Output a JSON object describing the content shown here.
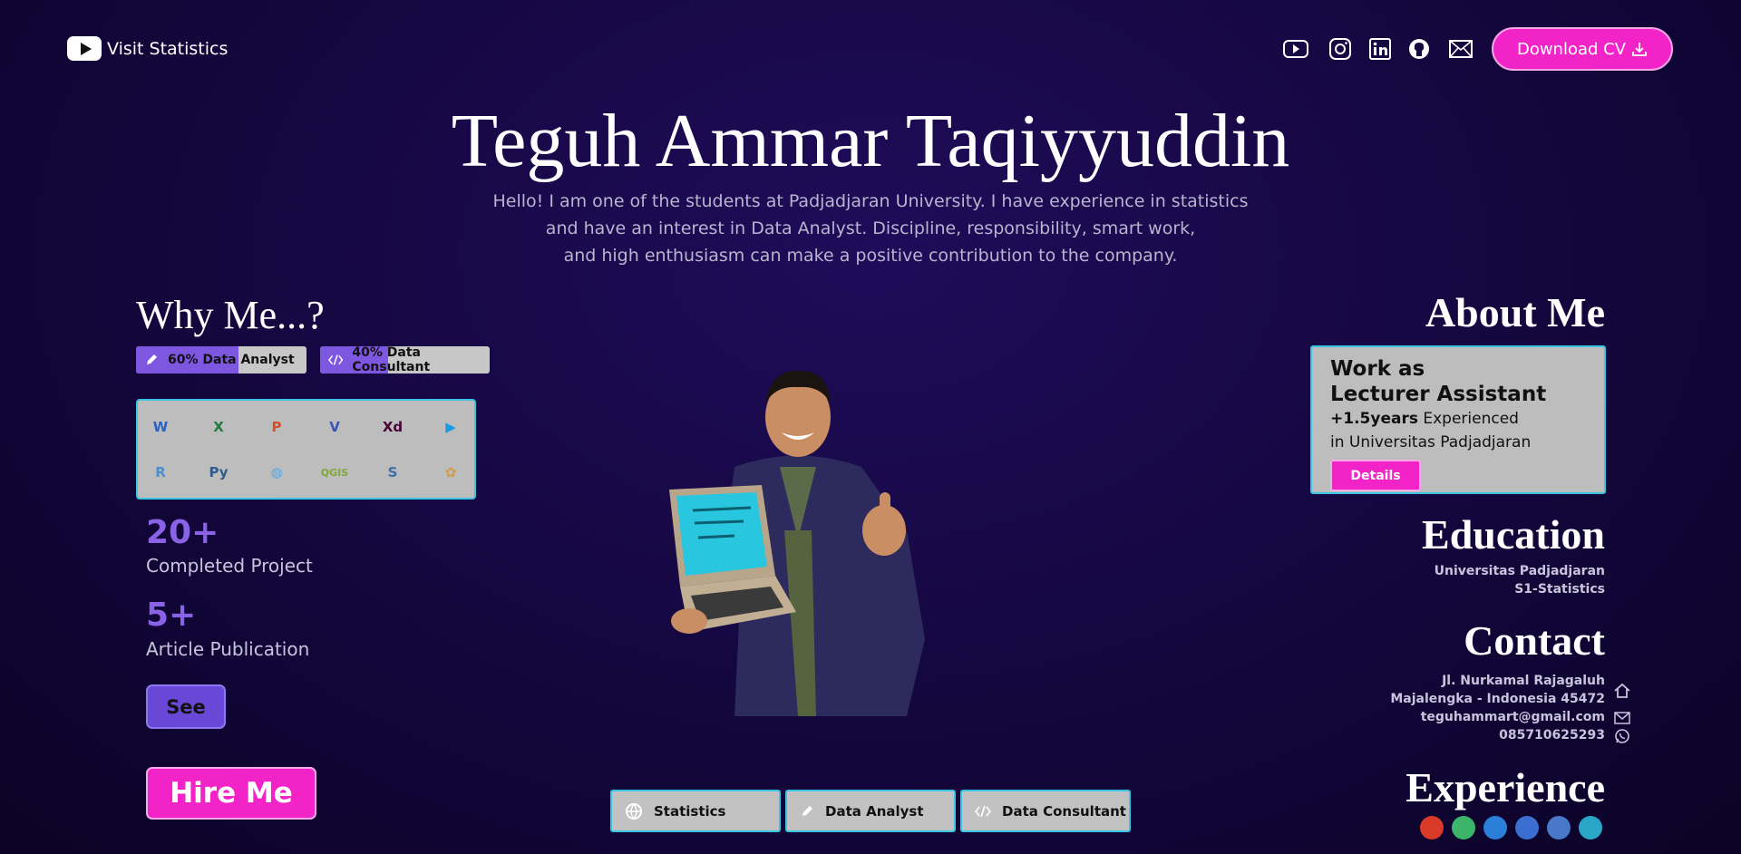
{
  "nav": {
    "brand_label": "Visit Statistics",
    "social_icons": [
      "youtube-icon",
      "instagram-icon",
      "linkedin-icon",
      "github-icon",
      "mail-icon"
    ],
    "download_cv_label": "Download CV"
  },
  "hero": {
    "name": "Teguh Ammar Taqiyyuddin",
    "intro_lines": [
      "Hello! I am one of the students at Padjadjaran University. I have experience in statistics",
      "and have an interest in Data Analyst. Discipline, responsibility, smart work,",
      "and high enthusiasm can make a positive contribution to the company."
    ]
  },
  "why_me": {
    "title": "Why Me...?",
    "skills": [
      {
        "label": "60% Data Analyst",
        "percent": 60,
        "icon": "pen-icon"
      },
      {
        "label": "40% Data Consultant",
        "percent": 40,
        "icon": "code-icon"
      }
    ],
    "tools": [
      {
        "name": "word-icon",
        "glyph": "W",
        "color": "#2b5fc4"
      },
      {
        "name": "excel-icon",
        "glyph": "X",
        "color": "#1f7a43"
      },
      {
        "name": "powerpoint-icon",
        "glyph": "P",
        "color": "#d2502c"
      },
      {
        "name": "visio-icon",
        "glyph": "V",
        "color": "#3a55b8"
      },
      {
        "name": "adobe-xd-icon",
        "glyph": "Xd",
        "color": "#470137"
      },
      {
        "name": "google-play-icon",
        "glyph": "▶",
        "color": "#1a9be0"
      },
      {
        "name": "r-icon",
        "glyph": "R",
        "color": "#4b8fd0"
      },
      {
        "name": "python-icon",
        "glyph": "Py",
        "color": "#2f5c8a"
      },
      {
        "name": "globe-icon",
        "glyph": "◍",
        "color": "#5aa7e0"
      },
      {
        "name": "qgis-icon",
        "glyph": "QGIS",
        "color": "#7ea83a"
      },
      {
        "name": "spss-icon",
        "glyph": "S",
        "color": "#3f6fa8"
      },
      {
        "name": "minitab-icon",
        "glyph": "✿",
        "color": "#d39b4a"
      }
    ],
    "stats": [
      {
        "value": "20+",
        "label": "Completed Project"
      },
      {
        "value": "5+",
        "label": "Article Publication"
      }
    ],
    "see_label": "See",
    "hire_label": "Hire Me"
  },
  "tabs": [
    {
      "label": "Statistics",
      "icon": "globe-icon"
    },
    {
      "label": "Data Analyst",
      "icon": "pen-icon"
    },
    {
      "label": "Data Consultant",
      "icon": "code-icon"
    }
  ],
  "about": {
    "title": "About Me",
    "work_line1": "Work as",
    "work_line2": "Lecturer Assistant",
    "years": "+1.5years",
    "experienced": " Experienced",
    "place": "in Universitas Padjadjaran",
    "details_label": "Details"
  },
  "education": {
    "title": "Education",
    "school": "Universitas Padjadjaran",
    "degree": "S1-Statistics"
  },
  "contact": {
    "title": "Contact",
    "address1": "Jl. Nurkamal Rajagaluh",
    "address2": "Majalengka - Indonesia 45472",
    "email": "teguhammart@gmail.com",
    "phone": "085710625293"
  },
  "experience": {
    "title": "Experience",
    "logos": [
      {
        "name": "unpad-logo-icon",
        "color": "#d93a2a"
      },
      {
        "name": "u-logo-icon",
        "color": "#3cb46a"
      },
      {
        "name": "wave-logo-icon",
        "color": "#2b7fd8"
      },
      {
        "name": "jet-logo-icon",
        "color": "#3a6ed0"
      },
      {
        "name": "badge-logo-icon",
        "color": "#4a78c8"
      },
      {
        "name": "triangle-logo-icon",
        "color": "#2aa6c8"
      }
    ]
  }
}
